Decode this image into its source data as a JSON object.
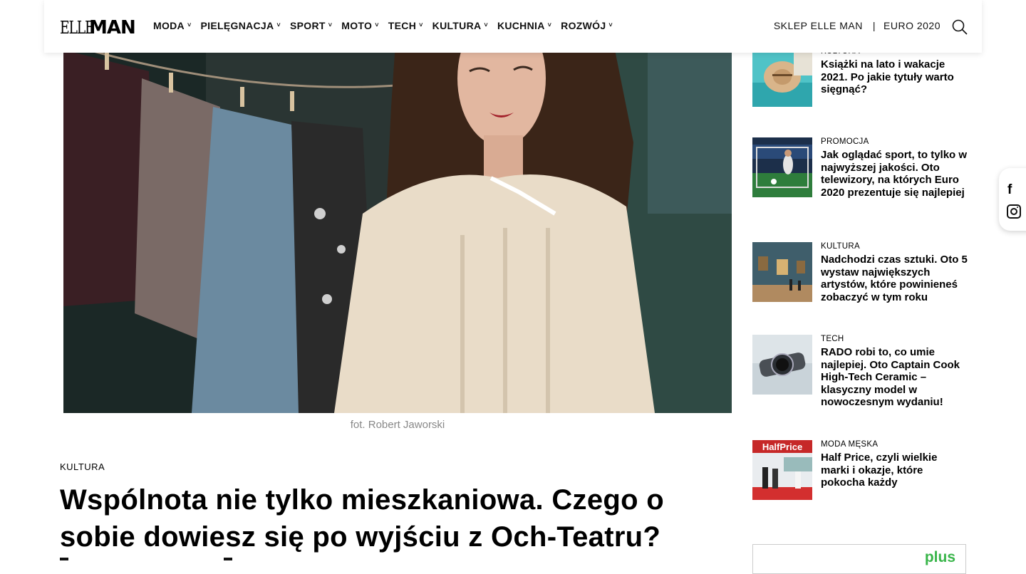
{
  "header": {
    "logo_elle": "ELLE",
    "logo_man": "MAN",
    "nav": [
      {
        "label": "MODA"
      },
      {
        "label": "PIELĘGNACJA"
      },
      {
        "label": "SPORT"
      },
      {
        "label": "MOTO"
      },
      {
        "label": "TECH"
      },
      {
        "label": "KULTURA"
      },
      {
        "label": "KUCHNIA"
      },
      {
        "label": "ROZWÓJ"
      }
    ],
    "chevron": "˅",
    "shop_link": "SKLEP ELLE MAN",
    "separator": "|",
    "euro_link": "EURO 2020"
  },
  "article": {
    "photo_caption": "fot. Robert Jaworski",
    "category": "KULTURA",
    "title": "Wspólnota nie tylko mieszkaniowa. Czego o sobie dowiesz się po wyjściu z Och-Teatru?"
  },
  "sidebar": [
    {
      "category": "KULTURA",
      "title": "Książki na lato i wakacje 2021. Po jakie tytuły warto sięgnąć?"
    },
    {
      "category": "PROMOCJA",
      "title": "Jak oglądać sport, to tylko w najwyższej jakości. Oto telewizory, na których Euro 2020 prezentuje się najlepiej"
    },
    {
      "category": "KULTURA",
      "title": "Nadchodzi czas sztuki. Oto 5 wystaw największych artystów, które powinieneś zobaczyć w tym roku"
    },
    {
      "category": "TECH",
      "title": "RADO robi to, co umie najlepiej. Oto Captain Cook High-Tech Ceramic – klasyczny model w nowoczesnym wydaniu!"
    },
    {
      "category": "MODA MĘSKA",
      "title": "Half Price, czyli wielkie marki i okazje, które pokocha każdy",
      "thumb_text": "HalfPrice"
    }
  ],
  "social": {
    "facebook_glyph": "f"
  },
  "ad": {
    "brand": "plus"
  },
  "colors": {
    "text": "#000000",
    "muted": "#888888",
    "ad_green": "#39b54a"
  }
}
